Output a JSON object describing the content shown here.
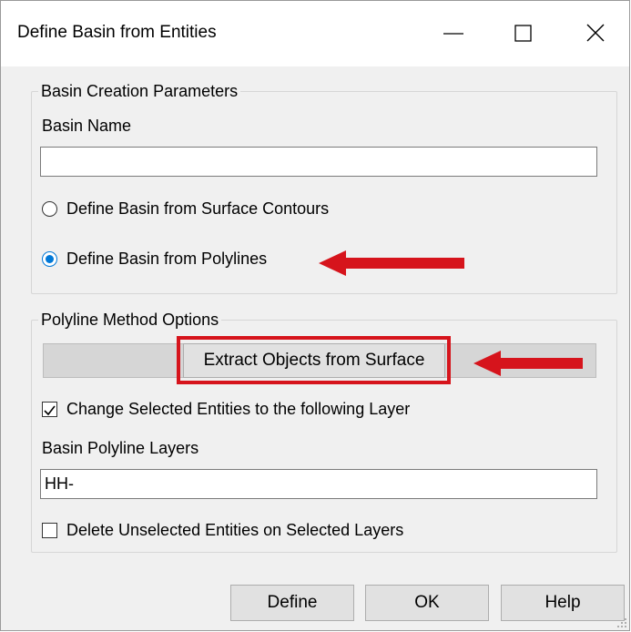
{
  "window": {
    "title": "Define Basin from Entities",
    "controls": [
      "minimize-icon",
      "maximize-icon",
      "close-icon"
    ]
  },
  "basin_creation": {
    "legend": "Basin Creation Parameters",
    "name_label": "Basin Name",
    "name_value": "",
    "option_contours": "Define Basin from Surface Contours",
    "option_polylines": "Define Basin from Polylines",
    "selected_option": "option_polylines"
  },
  "polyline_options": {
    "legend": "Polyline Method Options",
    "extract_button": "Extract Objects from Surface",
    "change_layer_label": "Change Selected Entities to the following Layer",
    "change_layer_checked": true,
    "layers_label": "Basin Polyline Layers",
    "layers_value": "HH-",
    "delete_unselected_label": "Delete Unselected Entities on Selected  Layers",
    "delete_unselected_checked": false
  },
  "footer": {
    "define": "Define",
    "ok": "OK",
    "help": "Help"
  },
  "annotations": {
    "color": "#d6141c"
  }
}
